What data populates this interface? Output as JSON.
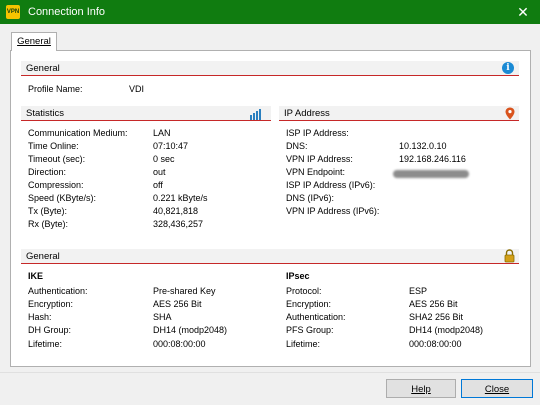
{
  "window": {
    "title": "Connection Info",
    "app_icon_text": "VPN",
    "close_glyph": "✕"
  },
  "tabs": [
    {
      "label": "General"
    }
  ],
  "general_top": {
    "title": "General",
    "icon": "info-icon",
    "profile_label": "Profile Name:",
    "profile_value": "VDI"
  },
  "statistics": {
    "title": "Statistics",
    "icon": "bar-chart-icon",
    "rows": [
      {
        "label": "Communication Medium:",
        "value": "LAN"
      },
      {
        "label": "Time Online:",
        "value": "07:10:47"
      },
      {
        "label": "Timeout (sec):",
        "value": "0  sec"
      },
      {
        "label": "Direction:",
        "value": "out"
      },
      {
        "label": "Compression:",
        "value": "off"
      },
      {
        "label": "Speed (KByte/s):",
        "value": "0.221  kByte/s"
      },
      {
        "label": "Tx (Byte):",
        "value": "40,821,818"
      },
      {
        "label": "Rx (Byte):",
        "value": "328,436,257"
      }
    ]
  },
  "ip_address": {
    "title": "IP Address",
    "icon": "location-pin-icon",
    "rows": [
      {
        "label": "ISP IP Address:",
        "value": ""
      },
      {
        "label": "DNS:",
        "value": "10.132.0.10"
      },
      {
        "label": "VPN IP Address:",
        "value": "192.168.246.116"
      },
      {
        "label": "VPN Endpoint:",
        "value": ""
      },
      {
        "label": "ISP IP Address (IPv6):",
        "value": ""
      },
      {
        "label": "DNS (IPv6):",
        "value": ""
      },
      {
        "label": "VPN IP Address (IPv6):",
        "value": ""
      }
    ]
  },
  "general_security": {
    "title": "General",
    "icon": "padlock-icon",
    "ike": {
      "title": "IKE",
      "rows": [
        {
          "label": "Authentication:",
          "value": "Pre-shared Key"
        },
        {
          "label": "Encryption:",
          "value": "AES 256 Bit"
        },
        {
          "label": "Hash:",
          "value": "SHA"
        },
        {
          "label": "DH Group:",
          "value": "DH14 (modp2048)"
        },
        {
          "label": "Lifetime:",
          "value": "000:08:00:00"
        }
      ]
    },
    "ipsec": {
      "title": "IPsec",
      "rows": [
        {
          "label": "Protocol:",
          "value": "ESP"
        },
        {
          "label": "Encryption:",
          "value": "AES 256 Bit"
        },
        {
          "label": "Authentication:",
          "value": "SHA2 256 Bit"
        },
        {
          "label": "PFS Group:",
          "value": "DH14 (modp2048)"
        },
        {
          "label": "Lifetime:",
          "value": "000:08:00:00"
        }
      ]
    }
  },
  "buttons": {
    "help": "Help",
    "close": "Close"
  },
  "colors": {
    "titlebar": "#107c10",
    "accent_line": "#c62828",
    "info_blue": "#1a8ad4",
    "pin_red": "#d9541e",
    "padlock_gold": "#d4a017"
  }
}
